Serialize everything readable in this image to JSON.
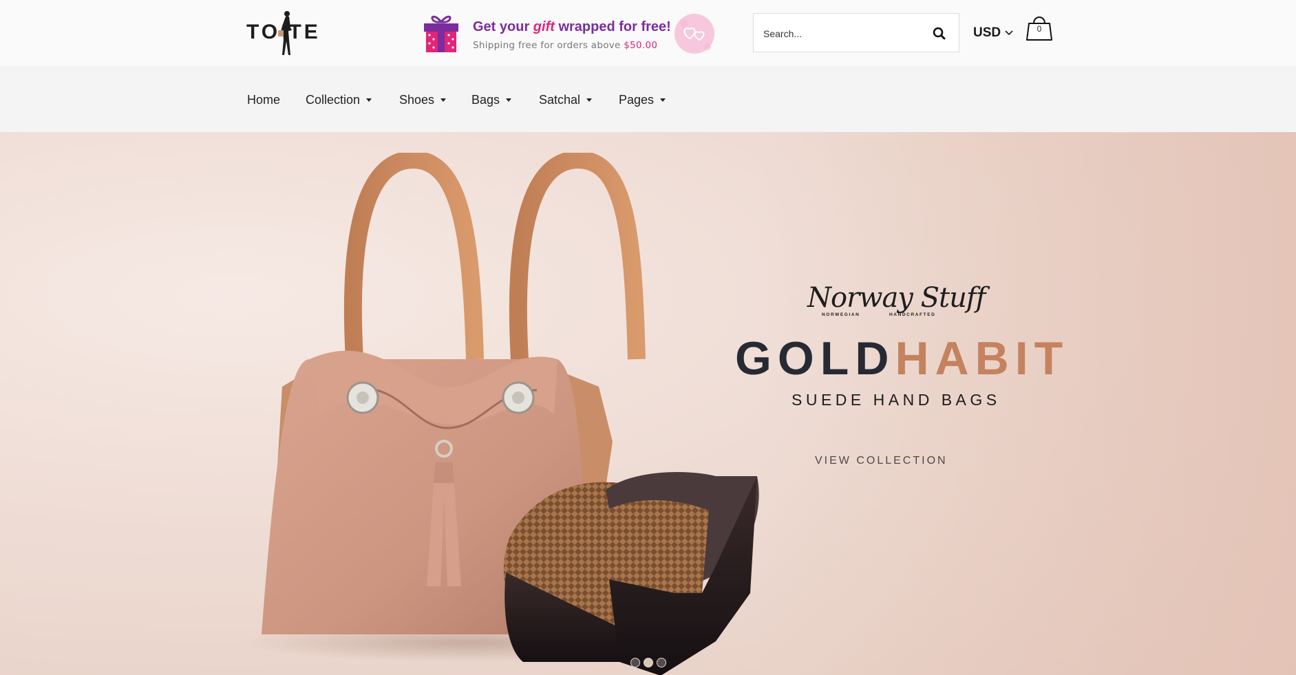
{
  "header": {
    "logo": {
      "text": "TO TE"
    },
    "promo": {
      "line1_pre": "Get your ",
      "line1_gift": "gift",
      "line1_post": " wrapped for free!",
      "line2_pre": "Shipping free for orders above ",
      "line2_amount": "$50.00"
    },
    "search": {
      "placeholder": "Search..."
    },
    "currency": {
      "selected": "USD"
    },
    "cart": {
      "count": "0"
    }
  },
  "nav": {
    "items": [
      {
        "label": "Home",
        "dropdown": false
      },
      {
        "label": "Collection",
        "dropdown": true
      },
      {
        "label": "Shoes",
        "dropdown": true
      },
      {
        "label": "Bags",
        "dropdown": true
      },
      {
        "label": "Satchal",
        "dropdown": true
      },
      {
        "label": "Pages",
        "dropdown": true
      }
    ]
  },
  "hero": {
    "brand": "Norway Stuff",
    "brand_sub_left": "NORWEGIAN",
    "brand_sub_right": "HANDCRAFTED",
    "headline_part1": "GOLD",
    "headline_part2": "HABIT",
    "subheadline": "SUEDE HAND BAGS",
    "cta": "VIEW COLLECTION",
    "slides": {
      "count": 3,
      "active": 2
    }
  },
  "colors": {
    "accent": "#c4825e",
    "headline_dark": "#272a33",
    "promo_purple": "#7b2c9e",
    "promo_pink": "#e0257a",
    "hero_bg": "#eedcd4"
  },
  "icons": {
    "search": "search-icon",
    "currency_dropdown": "chevron-down-icon",
    "cart": "shopping-bag-icon",
    "promo_gift": "gift-box-icon",
    "promo_hearts": "hearts-icon"
  }
}
